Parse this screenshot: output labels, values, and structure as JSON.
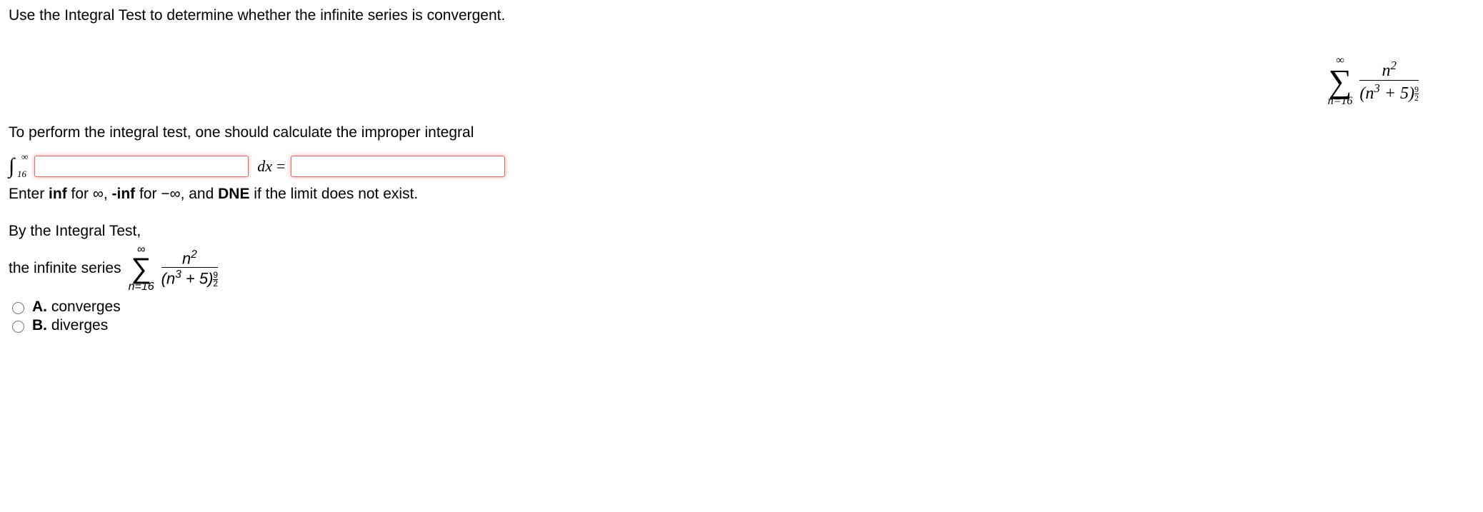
{
  "question": "Use the Integral Test to determine whether the infinite series is convergent.",
  "series": {
    "upper": "∞",
    "lower": "n=16",
    "numerator_base": "n",
    "numerator_exp": "2",
    "den_left": "(n",
    "den_exp1": "3",
    "den_plus": " + 5)",
    "den_outer_exp_num": "9",
    "den_outer_exp_den": "2"
  },
  "perform_text": "To perform the integral test, one should calculate the improper integral",
  "integral": {
    "upper": "∞",
    "lower": "16",
    "dx": "dx",
    "equals": "="
  },
  "hint_prefix": "Enter ",
  "hint_inf": "inf",
  "hint_for1": " for ∞, ",
  "hint_ninf": "-inf",
  "hint_for2": " for −∞, and ",
  "hint_dne": "DNE",
  "hint_suffix": " if the limit does not exist.",
  "conclusion_intro": "By the Integral Test,",
  "conclusion_prefix": "the infinite series",
  "options": {
    "a_letter": "A.",
    "a_text": " converges",
    "b_letter": "B.",
    "b_text": " diverges"
  }
}
